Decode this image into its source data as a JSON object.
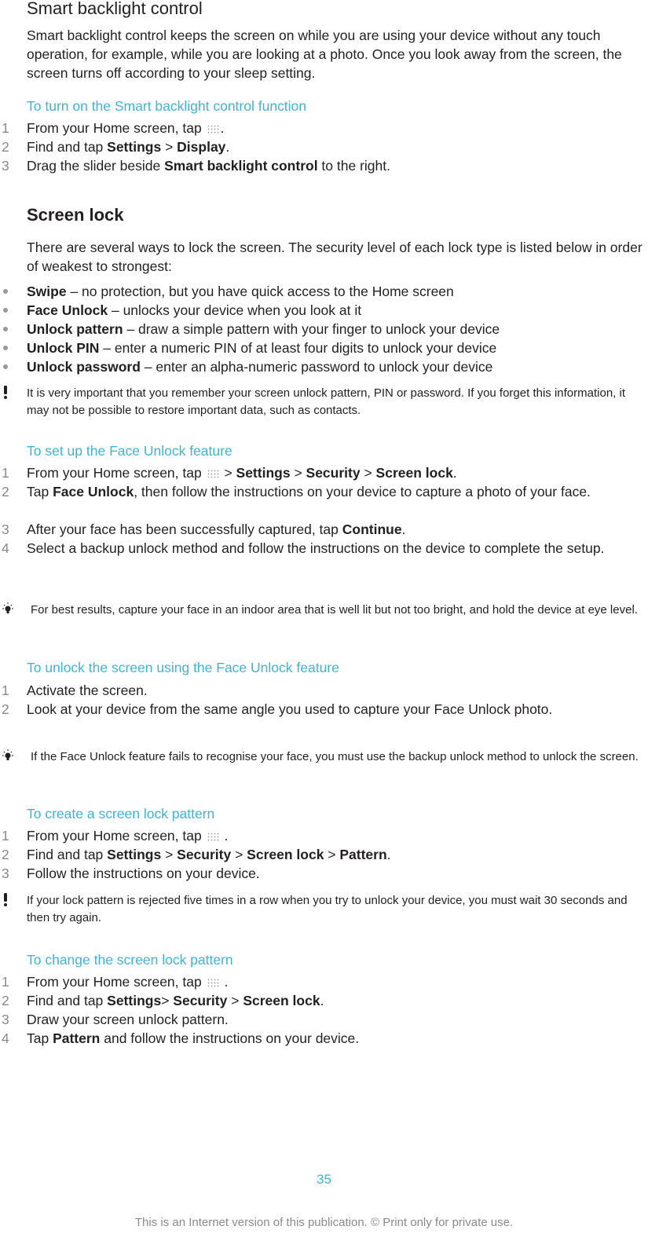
{
  "colors": {
    "accent": "#3eb4d8",
    "text": "#231f20",
    "muted": "#8a8a8a"
  },
  "section1": {
    "title": "Smart backlight control",
    "body": "Smart backlight control keeps the screen on while you are using your device without any touch operation, for example, while you are looking at a photo. Once you look away from the screen, the screen turns off according to your sleep setting.",
    "procedure": {
      "title": "To turn on the Smart backlight control function",
      "steps": [
        {
          "num": "1",
          "parts": [
            "From your Home screen, tap ",
            "[apps-grid-icon]",
            "."
          ]
        },
        {
          "num": "2",
          "parts": [
            "Find and tap ",
            "**Settings",
            " > ",
            "**Display",
            "."
          ]
        },
        {
          "num": "3",
          "parts": [
            "Drag the slider beside ",
            "**Smart backlight control",
            " to the right."
          ]
        }
      ]
    }
  },
  "section2": {
    "title": "Screen lock",
    "body": "There are several ways to lock the screen. The security level of each lock type is listed below in order of weakest to strongest:",
    "bullets": [
      {
        "term": "Swipe",
        "desc": " – no protection, but you have quick access to the Home screen"
      },
      {
        "term": "Face Unlock",
        "desc": " – unlocks your device when you look at it"
      },
      {
        "term": "Unlock pattern",
        "desc": " – draw a simple pattern with your finger to unlock your device"
      },
      {
        "term": "Unlock PIN",
        "desc": " – enter a numeric PIN of at least four digits to unlock your device"
      },
      {
        "term": "Unlock password",
        "desc": " – enter an alpha-numeric password to unlock your device"
      }
    ],
    "warning": "It is very important that you remember your screen unlock pattern, PIN or password. If you forget this information, it may not be possible to restore important data, such as contacts."
  },
  "face_setup": {
    "title": "To set up the Face Unlock feature",
    "steps": [
      {
        "num": "1",
        "parts": [
          "From your Home screen, tap ",
          "[apps-grid-icon]",
          " > ",
          "**Settings",
          " > ",
          "**Security",
          " > ",
          "**Screen lock",
          "."
        ]
      },
      {
        "num": "2",
        "parts": [
          "Tap ",
          "**Face Unlock",
          ", then follow the instructions on your device to capture a photo of your face."
        ]
      },
      {
        "num": "3",
        "parts": [
          "After your face has been successfully captured, tap ",
          "**Continue",
          "."
        ]
      },
      {
        "num": "4",
        "parts": [
          "Select a backup unlock method and follow the instructions on the device to complete the setup."
        ]
      }
    ],
    "tip": "For best results, capture your face in an indoor area that is well lit but not too bright, and hold the device at eye level."
  },
  "face_unlock": {
    "title": "To unlock the screen using the Face Unlock feature",
    "steps": [
      {
        "num": "1",
        "parts": [
          "Activate the screen."
        ]
      },
      {
        "num": "2",
        "parts": [
          "Look at your device from the same angle you used to capture your Face Unlock photo."
        ]
      }
    ],
    "tip": "If the Face Unlock feature fails to recognise your face, you must use the backup unlock method to unlock the screen."
  },
  "create_pattern": {
    "title": "To create a screen lock pattern",
    "steps": [
      {
        "num": "1",
        "parts": [
          "From your Home screen, tap ",
          "[apps-grid-icon]",
          " ."
        ]
      },
      {
        "num": "2",
        "parts": [
          "Find and tap ",
          "**Settings",
          " > ",
          "**Security",
          " > ",
          "**Screen lock",
          " > ",
          "**Pattern",
          "."
        ]
      },
      {
        "num": "3",
        "parts": [
          "Follow the instructions on your device."
        ]
      }
    ],
    "warning": "If your lock pattern is rejected five times in a row when you try to unlock your device, you must wait 30 seconds and then try again."
  },
  "change_pattern": {
    "title": "To change the screen lock pattern",
    "steps": [
      {
        "num": "1",
        "parts": [
          "From your Home screen, tap ",
          "[apps-grid-icon]",
          " ."
        ]
      },
      {
        "num": "2",
        "parts": [
          "Find and tap ",
          "**Settings",
          "> ",
          "**Security",
          " > ",
          "**Screen lock",
          "."
        ]
      },
      {
        "num": "3",
        "parts": [
          "Draw your screen unlock pattern."
        ]
      },
      {
        "num": "4",
        "parts": [
          "Tap ",
          "**Pattern",
          " and follow the instructions on your device."
        ]
      }
    ]
  },
  "footer": {
    "page_number": "35",
    "note": "This is an Internet version of this publication. © Print only for private use."
  }
}
